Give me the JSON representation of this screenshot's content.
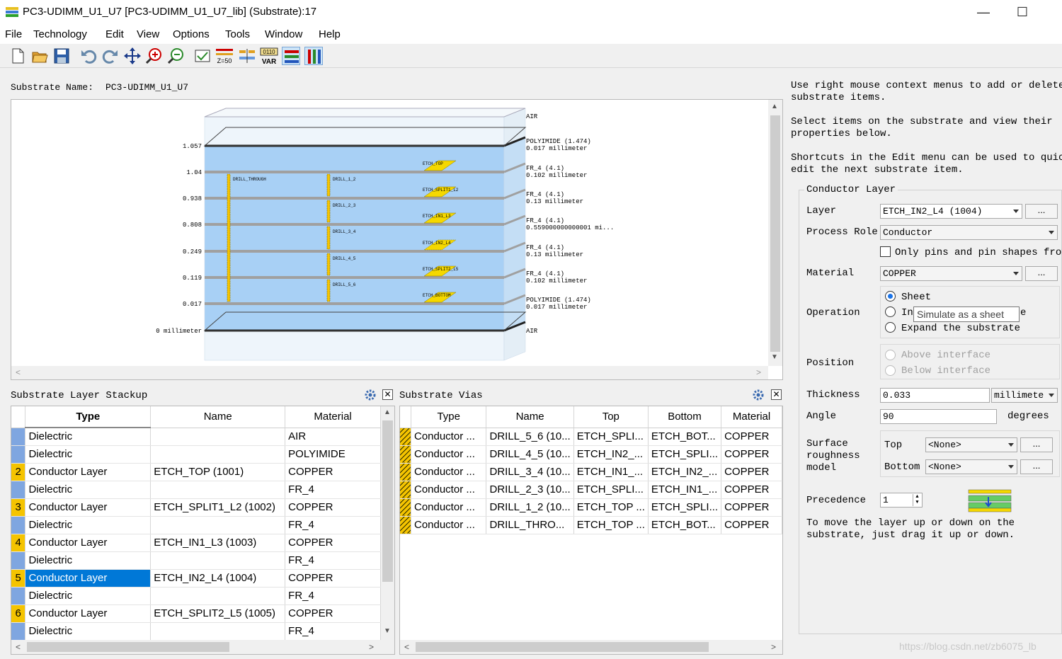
{
  "window": {
    "title": "PC3-UDIMM_U1_U7 [PC3-UDIMM_U1_U7_lib] (Substrate):17"
  },
  "menu": [
    "File",
    "Technology",
    "Edit",
    "View",
    "Options",
    "Tools",
    "Window",
    "Help"
  ],
  "toolbar": {
    "icons": [
      "new-icon",
      "open-icon",
      "save-icon",
      "undo-icon",
      "redo-icon",
      "pan-icon",
      "zoom-in-icon",
      "zoom-out-icon",
      "check-icon",
      "z50-icon",
      "layer-compare-icon",
      "var-icon",
      "stack-view-icon",
      "layer-view-icon"
    ],
    "z50_label": "Z=50",
    "var_top": "0110",
    "var_label": "VAR"
  },
  "substrate": {
    "name_label": "Substrate Name:",
    "name": "PC3-UDIMM_U1_U7"
  },
  "diagram": {
    "interface_labels": [
      "1.057",
      "1.04",
      "0.938",
      "0.808",
      "0.249",
      "0.119",
      "0.017",
      "0 millimeter"
    ],
    "layer_labels": [
      {
        "name": "AIR",
        "detail": ""
      },
      {
        "name": "POLYIMIDE (1.474)",
        "detail": "0.017 millimeter"
      },
      {
        "name": "FR_4 (4.1)",
        "detail": "0.102 millimeter"
      },
      {
        "name": "FR_4 (4.1)",
        "detail": "0.13 millimeter"
      },
      {
        "name": "FR_4 (4.1)",
        "detail": "0.559000000000001 mi..."
      },
      {
        "name": "FR_4 (4.1)",
        "detail": "0.13 millimeter"
      },
      {
        "name": "FR_4 (4.1)",
        "detail": "0.102 millimeter"
      },
      {
        "name": "POLYIMIDE (1.474)",
        "detail": "0.017 millimeter"
      },
      {
        "name": "AIR",
        "detail": ""
      }
    ],
    "etch_labels": [
      "ETCH_TOP",
      "ETCH_SPLIT1_L2",
      "ETCH_IN1_L3",
      "ETCH_IN2_L4",
      "ETCH_SPLIT2_L5",
      "ETCH_BOTTOM"
    ],
    "drill_labels": [
      "DRILL_THROUGH",
      "DRILL_1_2",
      "DRILL_2_3",
      "DRILL_3_4",
      "DRILL_4_5",
      "DRILL_5_6"
    ]
  },
  "stackup": {
    "title": "Substrate Layer Stackup",
    "columns": [
      "Type",
      "Name",
      "Material"
    ],
    "rows": [
      {
        "num": "",
        "kind": "dielectric",
        "type": "Dielectric",
        "name": "",
        "material": "AIR"
      },
      {
        "num": "",
        "kind": "dielectric",
        "type": "Dielectric",
        "name": "",
        "material": "POLYIMIDE"
      },
      {
        "num": "2",
        "kind": "conductor",
        "type": "Conductor Layer",
        "name": "ETCH_TOP (1001)",
        "material": "COPPER"
      },
      {
        "num": "",
        "kind": "dielectric",
        "type": "Dielectric",
        "name": "",
        "material": "FR_4"
      },
      {
        "num": "3",
        "kind": "conductor",
        "type": "Conductor Layer",
        "name": "ETCH_SPLIT1_L2 (1002)",
        "material": "COPPER"
      },
      {
        "num": "",
        "kind": "dielectric",
        "type": "Dielectric",
        "name": "",
        "material": "FR_4"
      },
      {
        "num": "4",
        "kind": "conductor",
        "type": "Conductor Layer",
        "name": "ETCH_IN1_L3 (1003)",
        "material": "COPPER"
      },
      {
        "num": "",
        "kind": "dielectric",
        "type": "Dielectric",
        "name": "",
        "material": "FR_4"
      },
      {
        "num": "5",
        "kind": "conductor",
        "type": "Conductor Layer",
        "name": "ETCH_IN2_L4 (1004)",
        "material": "COPPER",
        "selected": true
      },
      {
        "num": "",
        "kind": "dielectric",
        "type": "Dielectric",
        "name": "",
        "material": "FR_4"
      },
      {
        "num": "6",
        "kind": "conductor",
        "type": "Conductor Layer",
        "name": "ETCH_SPLIT2_L5 (1005)",
        "material": "COPPER"
      },
      {
        "num": "",
        "kind": "dielectric",
        "type": "Dielectric",
        "name": "",
        "material": "FR_4"
      }
    ]
  },
  "vias": {
    "title": "Substrate Vias",
    "columns": [
      "Type",
      "Name",
      "Top",
      "Bottom",
      "Material"
    ],
    "rows": [
      {
        "type": "Conductor ...",
        "name": "DRILL_5_6 (10...",
        "top": "ETCH_SPLI...",
        "bottom": "ETCH_BOT...",
        "material": "COPPER"
      },
      {
        "type": "Conductor ...",
        "name": "DRILL_4_5 (10...",
        "top": "ETCH_IN2_...",
        "bottom": "ETCH_SPLI...",
        "material": "COPPER"
      },
      {
        "type": "Conductor ...",
        "name": "DRILL_3_4 (10...",
        "top": "ETCH_IN1_...",
        "bottom": "ETCH_IN2_...",
        "material": "COPPER"
      },
      {
        "type": "Conductor ...",
        "name": "DRILL_2_3 (10...",
        "top": "ETCH_SPLI...",
        "bottom": "ETCH_IN1_...",
        "material": "COPPER"
      },
      {
        "type": "Conductor ...",
        "name": "DRILL_1_2 (10...",
        "top": "ETCH_TOP ...",
        "bottom": "ETCH_SPLI...",
        "material": "COPPER"
      },
      {
        "type": "Conductor ...",
        "name": "DRILL_THRO...",
        "top": "ETCH_TOP ...",
        "bottom": "ETCH_BOT...",
        "material": "COPPER"
      }
    ]
  },
  "help": {
    "line1": "Use right mouse context menus to add or delete",
    "line2": "substrate items.",
    "line3": "Select items on the substrate and view their",
    "line4": "properties below.",
    "line5": "Shortcuts in the Edit menu can be used to quickl",
    "line6": "edit the next substrate item."
  },
  "props": {
    "group_title": "Conductor Layer",
    "layer_label": "Layer",
    "layer_value": "ETCH_IN2_L4 (1004)",
    "process_role_label": "Process Role",
    "process_role_value": "Conductor",
    "only_pins_label": "Only pins and pin shapes from",
    "material_label": "Material",
    "material_value": "COPPER",
    "operation_label": "Operation",
    "op_sheet": "Sheet",
    "op_into": "In",
    "op_into_tail": "e",
    "op_expand": "Expand the substrate",
    "tooltip": "Simulate as a sheet",
    "position_label": "Position",
    "pos_above": "Above interface",
    "pos_below": "Below interface",
    "thickness_label": "Thickness",
    "thickness_value": "0.033",
    "thickness_unit": "millimete",
    "angle_label": "Angle",
    "angle_value": "90",
    "angle_unit": "degrees",
    "roughness_label_1": "Surface",
    "roughness_label_2": "roughness",
    "roughness_label_3": "model",
    "rough_top_label": "Top",
    "rough_top_value": "<None>",
    "rough_bottom_label": "Bottom",
    "rough_bottom_value": "<None>",
    "precedence_label": "Precedence",
    "precedence_value": "1",
    "hint1": "To move the layer up or down on the",
    "hint2": "substrate, just drag it up or down.",
    "more": "..."
  },
  "watermark": "https://blog.csdn.net/zb6075_lb"
}
